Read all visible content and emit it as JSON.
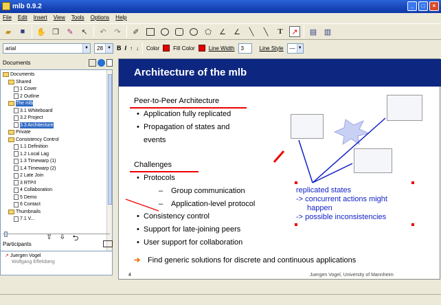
{
  "window": {
    "title": "mlb 0.9.2"
  },
  "menu": [
    "File",
    "Edit",
    "Insert",
    "View",
    "Tools",
    "Options",
    "Help"
  ],
  "toolbar2": {
    "font": "arial",
    "size": "28",
    "bold": "B",
    "italic": "I",
    "color_label": "Color",
    "fill_color_label": "Fill Color",
    "line_width_label": "Line Width",
    "line_width_value": "3",
    "line_style_label": "Line Style",
    "accent_red": "#e00000"
  },
  "documents_panel": {
    "title": "Documents",
    "tree": [
      {
        "label": "Documents",
        "kind": "folder"
      },
      {
        "label": "Shared",
        "kind": "folder"
      },
      {
        "label": "1 Cover",
        "kind": "page"
      },
      {
        "label": "2 Outline",
        "kind": "page"
      },
      {
        "label": "The mlb",
        "kind": "folder",
        "selected": true
      },
      {
        "label": "3.1 Whiteboard",
        "kind": "page"
      },
      {
        "label": "3.2 Project",
        "kind": "page"
      },
      {
        "label": "3.3 Architecture",
        "kind": "page",
        "selected": true
      },
      {
        "label": "Private",
        "kind": "folder"
      },
      {
        "label": "Consistency Control",
        "kind": "folder"
      },
      {
        "label": "1.1 Definition",
        "kind": "page"
      },
      {
        "label": "1.2 Local Lag",
        "kind": "page"
      },
      {
        "label": "1.3 Timewarp (1)",
        "kind": "page"
      },
      {
        "label": "1.4 Timewarp (2)",
        "kind": "page"
      },
      {
        "label": "2 Late Join",
        "kind": "page"
      },
      {
        "label": "3 RTP/I",
        "kind": "page"
      },
      {
        "label": "4 Collaboration",
        "kind": "page"
      },
      {
        "label": "5 Demo",
        "kind": "page"
      },
      {
        "label": "6 Contact",
        "kind": "page"
      },
      {
        "label": "Thumbnails",
        "kind": "folder"
      },
      {
        "label": "7.1 V...",
        "kind": "page"
      }
    ]
  },
  "participants_panel": {
    "title": "Participants",
    "users": [
      "Juergen Vogel",
      "Wolfgang Effelsberg"
    ]
  },
  "slide": {
    "title": "Architecture of the mlb",
    "section1": "Peer-to-Peer Architecture",
    "s1_bullets": [
      "Application fully replicated",
      "Propagation of states and",
      "events"
    ],
    "section2": "Challenges",
    "protocols": "Protocols",
    "sub": [
      "Group communication",
      "Application-level protocol"
    ],
    "s2_bullets": [
      "Consistency control",
      "Support for late-joining peers",
      "User support for collaboration"
    ],
    "conclusion": "Find generic solutions for discrete and continuous applications",
    "annotation": [
      "replicated states",
      "-> concurrent actions might",
      "happen",
      "-> possible inconsistencies"
    ],
    "page_number": "4",
    "author": "Juergen Vogel, University of Mannheim",
    "header_color": "#0d2780",
    "annotation_color": "#1020c8"
  }
}
